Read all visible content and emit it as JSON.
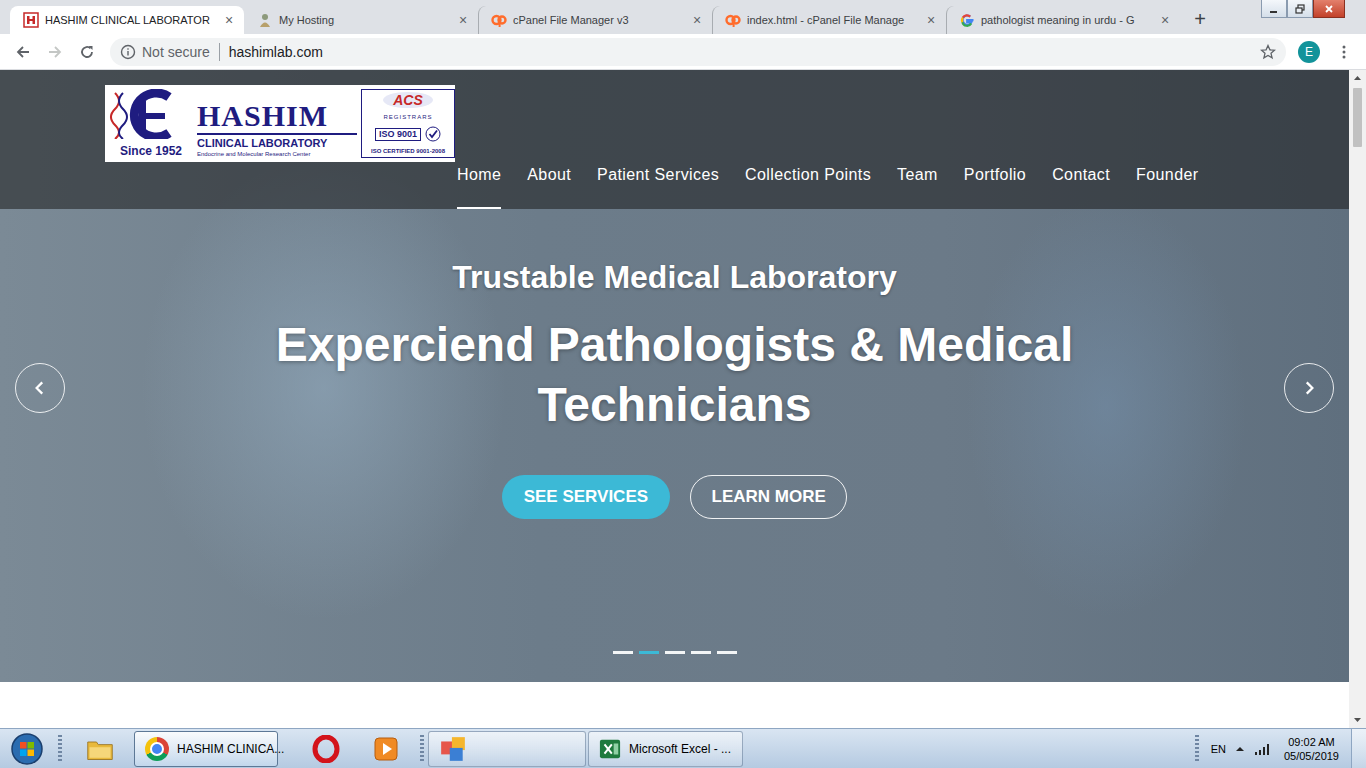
{
  "tabs": [
    {
      "label": "HASHIM CLINICAL LABORATOR",
      "selected": true,
      "close": "×"
    },
    {
      "label": "My Hosting",
      "selected": false,
      "close": "×"
    },
    {
      "label": "cPanel File Manager v3",
      "selected": false,
      "close": "×"
    },
    {
      "label": "index.html - cPanel File Manage",
      "selected": false,
      "close": "×"
    },
    {
      "label": "pathologist meaning in urdu - G",
      "selected": false,
      "close": "×"
    }
  ],
  "new_tab": "+",
  "toolbar": {
    "back_enabled": true,
    "forward_enabled": false,
    "security": "Not secure",
    "url": "hashimlab.com",
    "profile": "E"
  },
  "page": {
    "logo": {
      "since": "Since 1952",
      "name": "HASHIM",
      "subtitle": "CLINICAL LABORATORY",
      "tagline": "Endocrine and Molecular Research Center",
      "badge": "ACS",
      "registrar": "REGISTRARS",
      "iso": "ISO 9001",
      "certification": "ISO CERTIFIED 9001-2008"
    },
    "nav": [
      {
        "label": "Home",
        "selected": true
      },
      {
        "label": "About",
        "selected": false
      },
      {
        "label": "Patient Services",
        "selected": false
      },
      {
        "label": "Collection Points",
        "selected": false
      },
      {
        "label": "Team",
        "selected": false
      },
      {
        "label": "Portfolio",
        "selected": false
      },
      {
        "label": "Contact",
        "selected": false
      },
      {
        "label": "Founder",
        "selected": false
      }
    ],
    "hero": {
      "subtitle": "Trustable Medical Laboratory",
      "title": "Experciend Pathologists & Medical Technicians",
      "buttons": [
        "SEE SERVICES",
        "LEARN MORE"
      ],
      "slides": [
        {
          "selected": false
        },
        {
          "selected": true
        },
        {
          "selected": false
        },
        {
          "selected": false
        },
        {
          "selected": false
        }
      ]
    }
  },
  "taskbar": {
    "windows": [
      {
        "label": "HASHIM CLINICA...",
        "selected": true
      },
      {
        "label": "Microsoft Excel - ...",
        "selected": false
      }
    ],
    "language": "EN",
    "time": "09:02 AM",
    "date": "05/05/2019"
  }
}
